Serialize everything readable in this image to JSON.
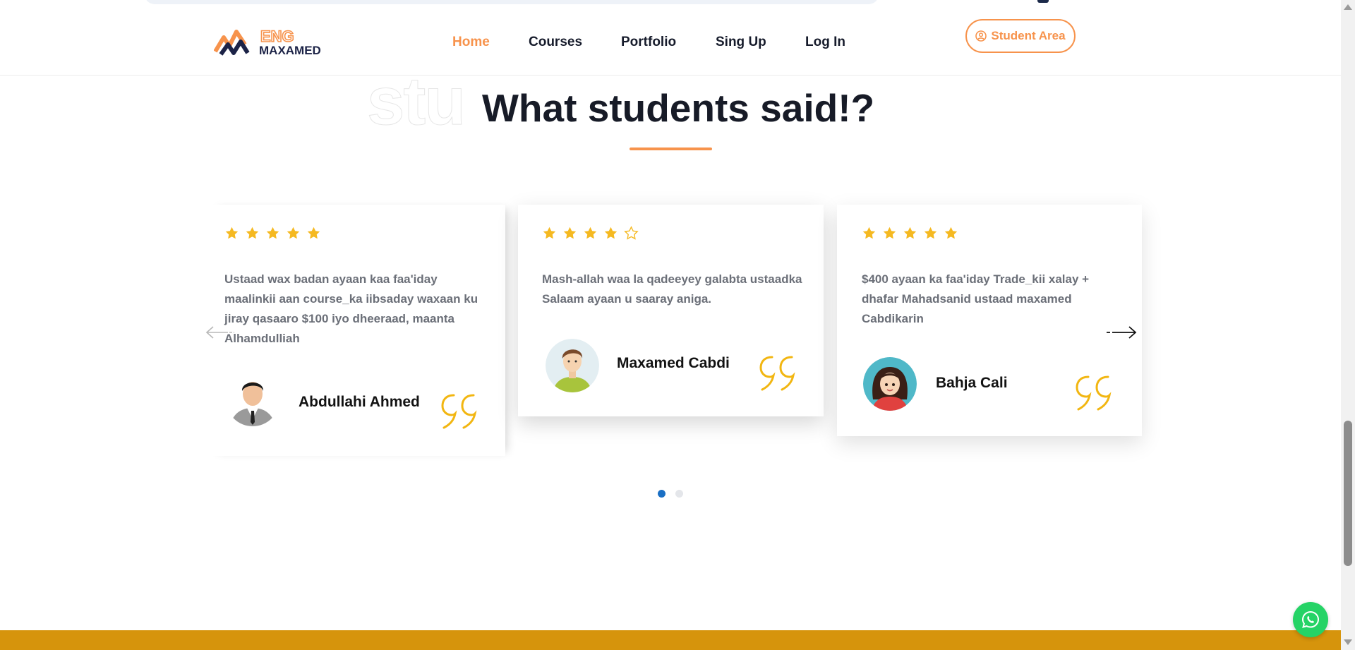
{
  "brand": {
    "logo_top": "ENG",
    "logo_bottom": "MAXAMED",
    "accent_color": "#f7934c",
    "dark_color": "#1c2347"
  },
  "nav": {
    "items": [
      {
        "label": "Home",
        "active": true
      },
      {
        "label": "Courses",
        "active": false
      },
      {
        "label": "Portfolio",
        "active": false
      },
      {
        "label": "Sing Up",
        "active": false
      },
      {
        "label": "Log In",
        "active": false
      }
    ],
    "student_area_label": "Student Area",
    "student_area_icon": "user-circle-icon"
  },
  "section": {
    "ghost_text": "stu",
    "title": "What students said!?"
  },
  "testimonials": [
    {
      "rating": 5,
      "text": "Ustaad wax badan ayaan kaa faa'iday maalinkii aan course_ka iibsaday waxaan ku jiray qasaaro $100 iyo dheeraad, maanta Alhamdulliah",
      "name": "Abdullahi Ahmed",
      "avatar_icon": "man-suit-avatar"
    },
    {
      "rating": 4,
      "text": "Mash-allah waa la qadeeyey galabta ustaadka Salaam ayaan u saaray aniga.",
      "name": "Maxamed Cabdi",
      "avatar_icon": "young-man-avatar"
    },
    {
      "rating": 5,
      "text": "$400 ayaan ka faa'iday Trade_kii xalay + dhafar Mahadsanid ustaad maxamed Cabdikarin",
      "name": "Bahja Cali",
      "avatar_icon": "woman-avatar"
    }
  ],
  "carousel": {
    "dots": 2,
    "active_dot": 0,
    "prev_icon": "arrow-left-icon",
    "next_icon": "arrow-right-icon"
  },
  "colors": {
    "star": "#f5b921",
    "quote": "#f2b611",
    "footer_band": "#d6940c",
    "whatsapp": "#25d366",
    "active_dot": "#1a6fc4"
  }
}
